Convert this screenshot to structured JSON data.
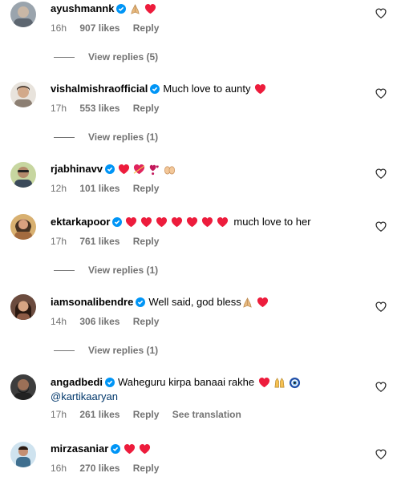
{
  "comments": [
    {
      "username": "ayushmannk",
      "text": "",
      "emojis": [
        "pray",
        "heart"
      ],
      "time": "16h",
      "likes": "907 likes",
      "reply": "Reply",
      "view_replies": "View replies (5)",
      "mention": "",
      "translate": ""
    },
    {
      "username": "vishalmishraofficial",
      "text": "Much love to aunty",
      "emojis": [
        "heart"
      ],
      "time": "17h",
      "likes": "553 likes",
      "reply": "Reply",
      "view_replies": "View replies (1)",
      "mention": "",
      "translate": ""
    },
    {
      "username": "rjabhinavv",
      "text": "",
      "emojis": [
        "heart",
        "heart-arrow",
        "heart-exclaim",
        "open-hands"
      ],
      "time": "12h",
      "likes": "101 likes",
      "reply": "Reply",
      "view_replies": "",
      "mention": "",
      "translate": ""
    },
    {
      "username": "ektarkapoor",
      "text": "much love to her",
      "emojis": [
        "heart",
        "heart",
        "heart",
        "heart",
        "heart",
        "heart",
        "heart"
      ],
      "time": "17h",
      "likes": "761 likes",
      "reply": "Reply",
      "view_replies": "View replies (1)",
      "mention": "",
      "translate": ""
    },
    {
      "username": "iamsonalibendre",
      "text": "Well said, god bless",
      "emojis": [
        "pray",
        "heart"
      ],
      "time": "14h",
      "likes": "306 likes",
      "reply": "Reply",
      "view_replies": "View replies (1)",
      "mention": "",
      "translate": ""
    },
    {
      "username": "angadbedi",
      "text": "Waheguru kirpa banaai rakhe",
      "emojis": [
        "heart",
        "raised-hands",
        "nazar"
      ],
      "time": "17h",
      "likes": "261 likes",
      "reply": "Reply",
      "view_replies": "",
      "mention": "@kartikaaryan",
      "translate": "See translation"
    },
    {
      "username": "mirzasaniar",
      "text": "",
      "emojis": [
        "heart",
        "heart"
      ],
      "time": "16h",
      "likes": "270 likes",
      "reply": "Reply",
      "view_replies": "",
      "mention": "",
      "translate": ""
    }
  ],
  "colors": {
    "verified": "#0095f6",
    "meta": "#737373",
    "heart": "#ed1c3c",
    "mention": "#00376b"
  },
  "icons": {
    "verified": "verified-badge-icon",
    "like": "heart-outline-icon"
  }
}
